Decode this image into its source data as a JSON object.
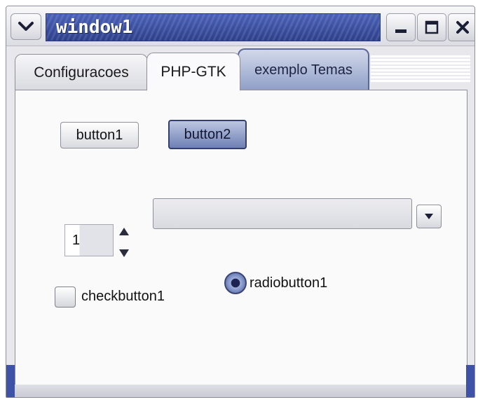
{
  "window": {
    "title": "window1",
    "accent_color": "#3a50a6"
  },
  "tabs": [
    {
      "label": "Configuracoes"
    },
    {
      "label": "PHP-GTK"
    },
    {
      "label": "exemplo Temas",
      "active": true
    }
  ],
  "buttons": {
    "button1": "button1",
    "button2": "button2"
  },
  "combo": {
    "value": ""
  },
  "spin": {
    "value": "1"
  },
  "checkbutton": {
    "label": "checkbutton1",
    "checked": false
  },
  "radiobutton": {
    "label": "radiobutton1",
    "selected": true
  },
  "icons": {
    "menu": "chevron-down-icon",
    "minimize": "minimize-icon",
    "maximize": "maximize-icon",
    "close": "close-icon"
  }
}
